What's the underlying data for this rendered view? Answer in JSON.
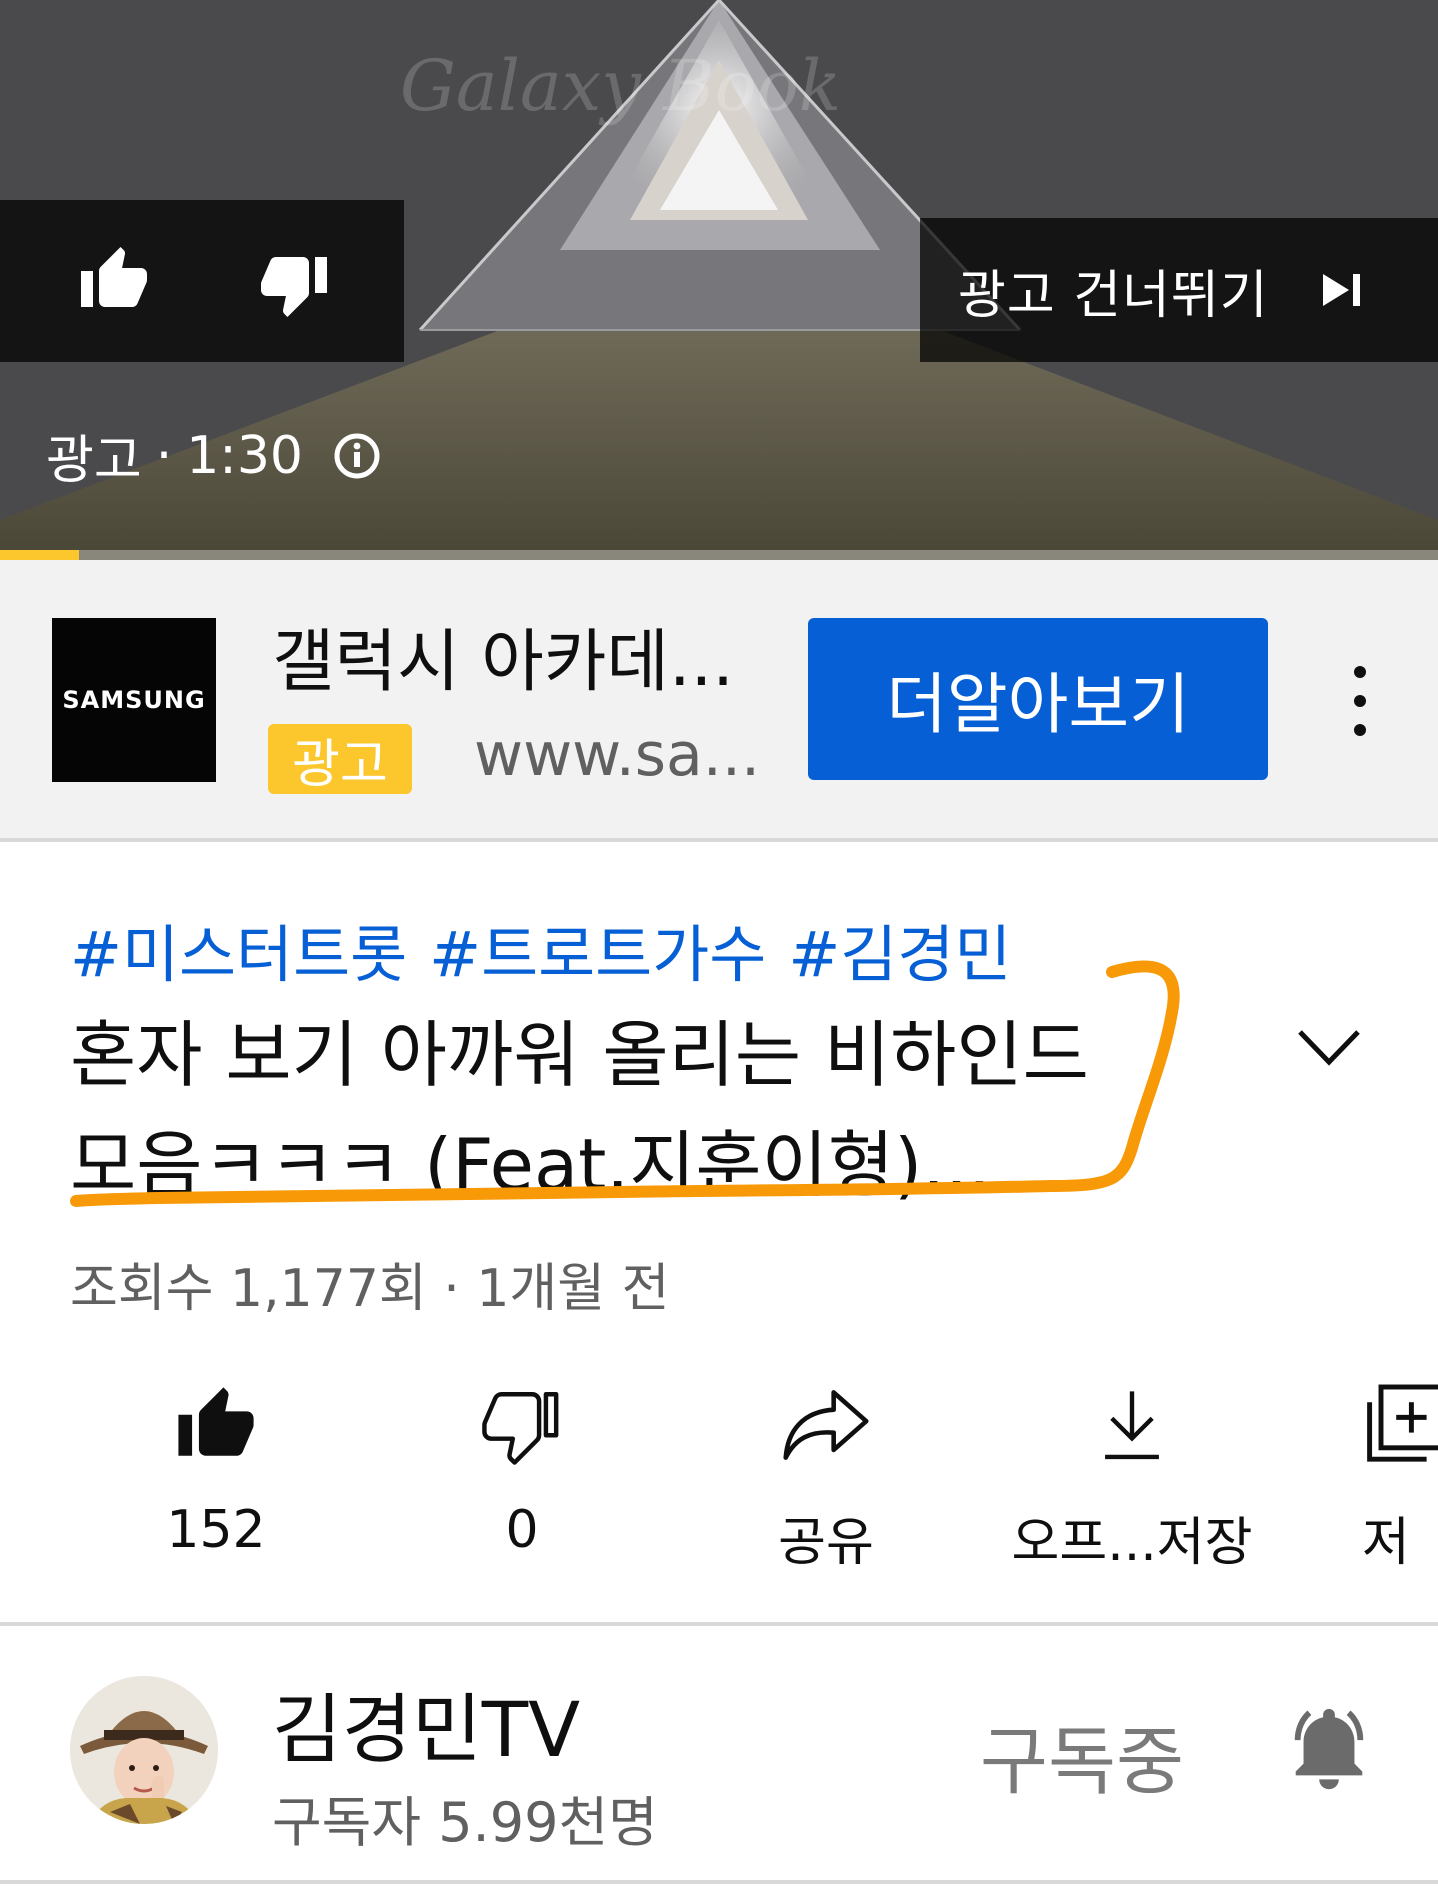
{
  "player": {
    "watermark": "Galaxy Book",
    "skip_label": "광고 건너뛰기",
    "ad_label": "광고",
    "ad_duration": "1:30",
    "progress_fraction": 0.055,
    "icons": {
      "like": "thumb-up-icon",
      "dislike": "thumb-down-icon",
      "skip": "skip-next-icon",
      "info": "info-icon"
    }
  },
  "ad": {
    "logo_text": "SAMSUNG",
    "title": "갤럭시 아카데...",
    "badge": "광고",
    "url": "www.sa...",
    "cta_label": "더알아보기",
    "colors": {
      "badge": "#fcc62d",
      "cta": "#065fd4"
    }
  },
  "video": {
    "hashtags": [
      "#미스터트롯",
      "#트로트가수",
      "#김경민"
    ],
    "title_line1": "혼자 보기 아까워 올리는 비하인드",
    "title_line2": "모음ㅋㅋㅋ (Feat.지훈이형)...",
    "views_text": "조회수 1,177회 · 1개월 전",
    "annotation_color": "#f89a08"
  },
  "actions": [
    {
      "name": "like",
      "icon": "thumb-up-filled-icon",
      "label": "152"
    },
    {
      "name": "dislike",
      "icon": "thumb-down-outline-icon",
      "label": "0"
    },
    {
      "name": "share",
      "icon": "share-arrow-icon",
      "label": "공유"
    },
    {
      "name": "download",
      "icon": "download-icon",
      "label": "오프...저장"
    },
    {
      "name": "save",
      "icon": "playlist-add-icon",
      "label": "저"
    }
  ],
  "channel": {
    "name": "김경민TV",
    "subscribers": "구독자 5.99천명",
    "subscribe_state": "구독중",
    "bell": "notification-bell-icon"
  }
}
